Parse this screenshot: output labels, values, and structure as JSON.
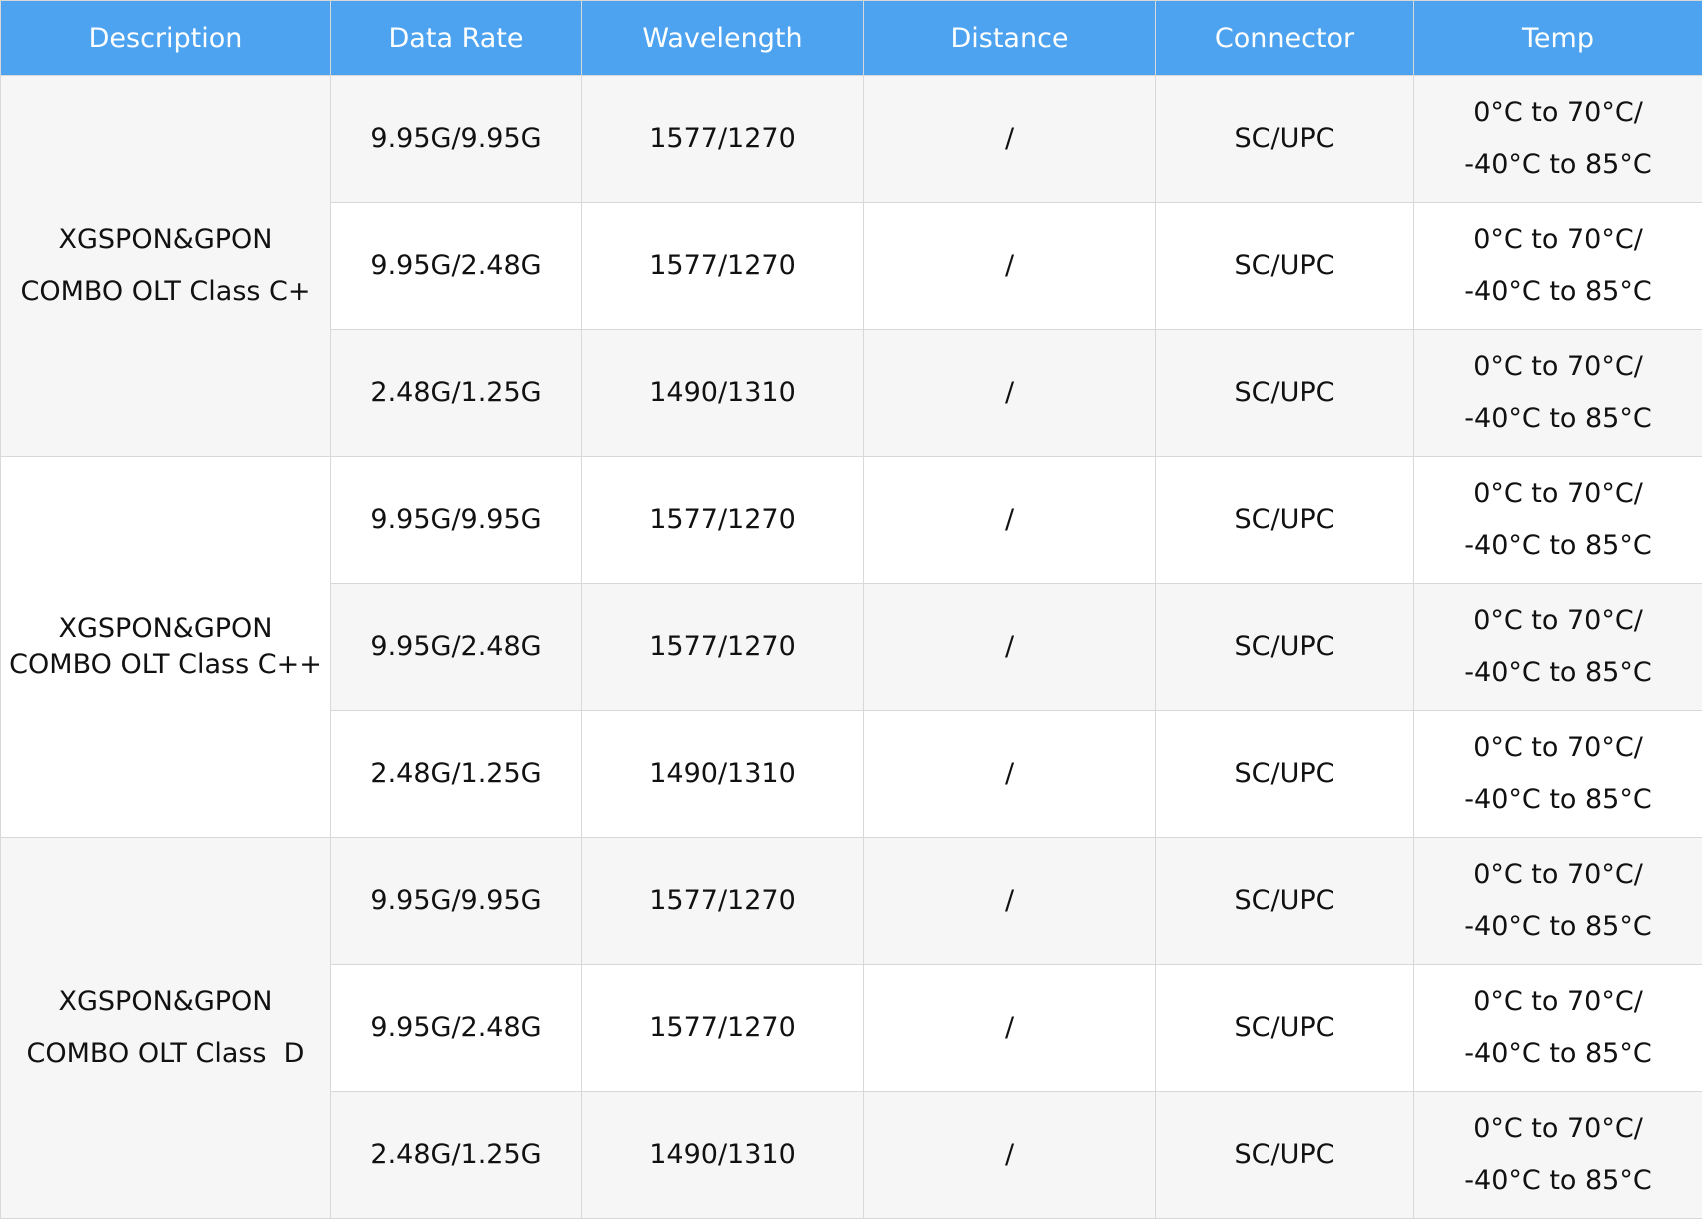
{
  "header": {
    "description": "Description",
    "data_rate": "Data Rate",
    "wavelength": "Wavelength",
    "distance": "Distance",
    "connector": "Connector",
    "temp": "Temp"
  },
  "groups": [
    {
      "desc_line1": "XGSPON&GPON",
      "desc_line2": "COMBO OLT Class C+",
      "rows": [
        {
          "data_rate": "9.95G/9.95G",
          "wavelength": "1577/1270",
          "distance": "/",
          "connector": "SC/UPC",
          "temp_line1": "0°C to 70°C/",
          "temp_line2": "-40°C to 85°C"
        },
        {
          "data_rate": "9.95G/2.48G",
          "wavelength": "1577/1270",
          "distance": "/",
          "connector": "SC/UPC",
          "temp_line1": "0°C to 70°C/",
          "temp_line2": "-40°C to 85°C"
        },
        {
          "data_rate": "2.48G/1.25G",
          "wavelength": "1490/1310",
          "distance": "/",
          "connector": "SC/UPC",
          "temp_line1": "0°C to 70°C/",
          "temp_line2": "-40°C to 85°C"
        }
      ]
    },
    {
      "desc_line1": "XGSPON&GPON",
      "desc_line2": "COMBO OLT Class C++",
      "rows": [
        {
          "data_rate": "9.95G/9.95G",
          "wavelength": "1577/1270",
          "distance": "/",
          "connector": "SC/UPC",
          "temp_line1": "0°C to 70°C/",
          "temp_line2": "-40°C to 85°C"
        },
        {
          "data_rate": "9.95G/2.48G",
          "wavelength": "1577/1270",
          "distance": "/",
          "connector": "SC/UPC",
          "temp_line1": "0°C to 70°C/",
          "temp_line2": "-40°C to 85°C"
        },
        {
          "data_rate": "2.48G/1.25G",
          "wavelength": "1490/1310",
          "distance": "/",
          "connector": "SC/UPC",
          "temp_line1": "0°C to 70°C/",
          "temp_line2": "-40°C to 85°C"
        }
      ]
    },
    {
      "desc_line1": "XGSPON&GPON",
      "desc_line2": "COMBO OLT Class  D",
      "rows": [
        {
          "data_rate": "9.95G/9.95G",
          "wavelength": "1577/1270",
          "distance": "/",
          "connector": "SC/UPC",
          "temp_line1": "0°C to 70°C/",
          "temp_line2": "-40°C to 85°C"
        },
        {
          "data_rate": "9.95G/2.48G",
          "wavelength": "1577/1270",
          "distance": "/",
          "connector": "SC/UPC",
          "temp_line1": "0°C to 70°C/",
          "temp_line2": "-40°C to 85°C"
        },
        {
          "data_rate": "2.48G/1.25G",
          "wavelength": "1490/1310",
          "distance": "/",
          "connector": "SC/UPC",
          "temp_line1": "0°C to 70°C/",
          "temp_line2": "-40°C to 85°C"
        }
      ]
    }
  ],
  "colors": {
    "header_bg": "#4da3f0",
    "header_text": "#ffffff",
    "row_alt_bg": "#f6f6f6",
    "row_bg": "#ffffff",
    "border": "#d8d8d8"
  }
}
